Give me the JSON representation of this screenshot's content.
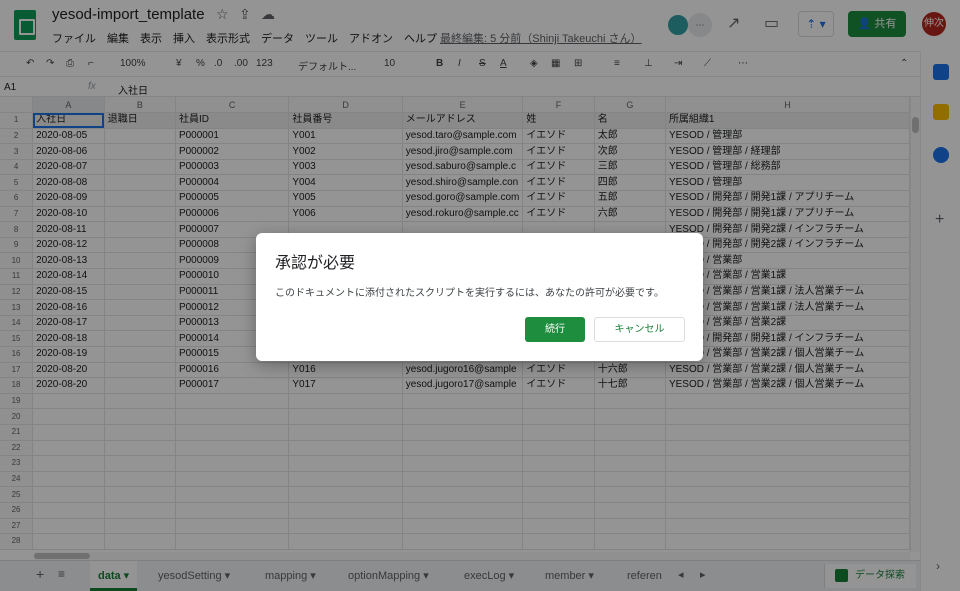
{
  "header": {
    "title": "yesod-import_template",
    "menu": [
      "ファイル",
      "編集",
      "表示",
      "挿入",
      "表示形式",
      "データ",
      "ツール",
      "アドオン",
      "ヘルプ"
    ],
    "last_edit": "最終編集: 5 分前（Shinji Takeuchi さん）",
    "share_label": "共有",
    "user_initials": "伸次"
  },
  "toolbar": {
    "zoom": "100%",
    "currency": "¥",
    "percent": "%",
    "dec_decrease": ".0",
    "dec_increase": ".00",
    "format": "123",
    "font": "デフォルト...",
    "font_size": "10",
    "bold": "B",
    "italic": "I",
    "strike": "S",
    "text_color": "A",
    "more": "⋯"
  },
  "formula_bar": {
    "cell_ref": "A1",
    "fx": "fx",
    "value": "入社日"
  },
  "grid": {
    "columns": [
      "A",
      "B",
      "C",
      "D",
      "E",
      "F",
      "G",
      "H"
    ],
    "header_row": [
      "入社日",
      "退職日",
      "社員ID",
      "社員番号",
      "メールアドレス",
      "姓",
      "名",
      "所属組織1"
    ],
    "rows": [
      [
        "2020-08-05",
        "",
        "P000001",
        "Y001",
        "yesod.taro@sample.com",
        "イエソド",
        "太郎",
        "YESOD / 管理部"
      ],
      [
        "2020-08-06",
        "",
        "P000002",
        "Y002",
        "yesod.jiro@sample.com",
        "イエソド",
        "次郎",
        "YESOD / 管理部 / 経理部"
      ],
      [
        "2020-08-07",
        "",
        "P000003",
        "Y003",
        "yesod.saburo@sample.c",
        "イエソド",
        "三郎",
        "YESOD / 管理部 / 総務部"
      ],
      [
        "2020-08-08",
        "",
        "P000004",
        "Y004",
        "yesod.shiro@sample.con",
        "イエソド",
        "四郎",
        "YESOD / 管理部"
      ],
      [
        "2020-08-09",
        "",
        "P000005",
        "Y005",
        "yesod.goro@sample.com",
        "イエソド",
        "五郎",
        "YESOD / 開発部 / 開発1課 / アプリチーム"
      ],
      [
        "2020-08-10",
        "",
        "P000006",
        "Y006",
        "yesod.rokuro@sample.cc",
        "イエソド",
        "六郎",
        "YESOD / 開発部 / 開発1課 / アプリチーム"
      ],
      [
        "2020-08-11",
        "",
        "P000007",
        "",
        "",
        "",
        "",
        "YESOD / 開発部 / 開発2課 / インフラチーム"
      ],
      [
        "2020-08-12",
        "",
        "P000008",
        "",
        "",
        "",
        "",
        "YESOD / 開発部 / 開発2課 / インフラチーム"
      ],
      [
        "2020-08-13",
        "",
        "P000009",
        "",
        "",
        "",
        "",
        "YESOD / 営業部"
      ],
      [
        "2020-08-14",
        "",
        "P000010",
        "",
        "",
        "",
        "",
        "YESOD / 営業部 / 営業1課"
      ],
      [
        "2020-08-15",
        "",
        "P000011",
        "",
        "",
        "",
        "",
        "YESOD / 営業部 / 営業1課 / 法人営業チーム"
      ],
      [
        "2020-08-16",
        "",
        "P000012",
        "",
        "",
        "",
        "",
        "YESOD / 営業部 / 営業1課 / 法人営業チーム"
      ],
      [
        "2020-08-17",
        "",
        "P000013",
        "",
        "",
        "",
        "",
        "YESOD / 営業部 / 営業2課"
      ],
      [
        "2020-08-18",
        "",
        "P000014",
        "",
        "",
        "",
        "",
        "YESOD / 開発部 / 開発1課 / インフラチーム"
      ],
      [
        "2020-08-19",
        "",
        "P000015",
        "Y015",
        "yesod.jugoro@sample.c",
        "イエソド",
        "十五郎",
        "YESOD / 営業部 / 営業2課 / 個人営業チーム"
      ],
      [
        "2020-08-20",
        "",
        "P000016",
        "Y016",
        "yesod.jugoro16@sample",
        "イエソド",
        "十六郎",
        "YESOD / 営業部 / 営業2課 / 個人営業チーム"
      ],
      [
        "2020-08-20",
        "",
        "P000017",
        "Y017",
        "yesod.jugoro17@sample",
        "イエソド",
        "十七郎",
        "YESOD / 営業部 / 営業2課 / 個人営業チーム"
      ]
    ],
    "row_count": 28
  },
  "sheets": {
    "tabs": [
      "data",
      "yesodSetting",
      "mapping",
      "optionMapping",
      "execLog",
      "member",
      "referen"
    ],
    "active": "data",
    "explore_label": "データ探索"
  },
  "dialog": {
    "title": "承認が必要",
    "message": "このドキュメントに添付されたスクリプトを実行するには、あなたの許可が必要です。",
    "continue_label": "続行",
    "cancel_label": "キャンセル"
  },
  "colors": {
    "accent_green": "#1e8e3e",
    "selection_blue": "#1a73e8"
  }
}
